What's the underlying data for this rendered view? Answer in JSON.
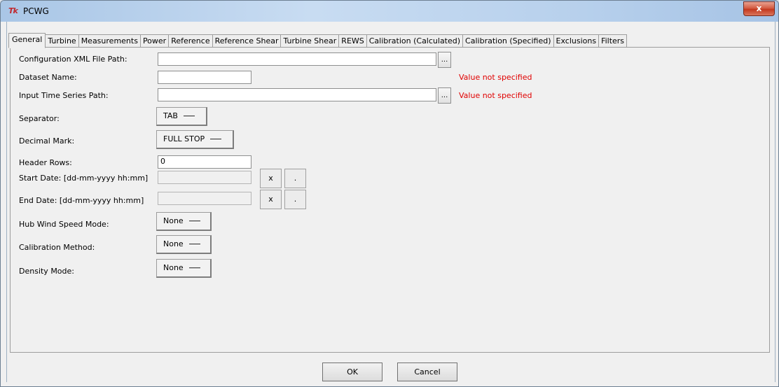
{
  "window": {
    "title": "PCWG",
    "logo": "Tk",
    "close_label": "x"
  },
  "tabs": [
    {
      "label": "General",
      "active": true
    },
    {
      "label": "Turbine"
    },
    {
      "label": "Measurements"
    },
    {
      "label": "Power"
    },
    {
      "label": "Reference"
    },
    {
      "label": "Reference Shear"
    },
    {
      "label": "Turbine Shear"
    },
    {
      "label": "REWS"
    },
    {
      "label": "Calibration (Calculated)"
    },
    {
      "label": "Calibration (Specified)"
    },
    {
      "label": "Exclusions"
    },
    {
      "label": "Filters"
    }
  ],
  "form": {
    "config_xml_label": "Configuration XML File Path:",
    "config_xml_value": "",
    "dataset_name_label": "Dataset Name:",
    "dataset_name_value": "",
    "dataset_name_error": "Value not specified",
    "input_ts_label": "Input Time Series Path:",
    "input_ts_value": "",
    "input_ts_error": "Value not specified",
    "browse_label": "...",
    "separator_label": "Separator:",
    "separator_value": "TAB",
    "decimal_label": "Decimal Mark:",
    "decimal_value": "FULL STOP",
    "header_rows_label": "Header Rows:",
    "header_rows_value": "0",
    "start_date_label": "Start Date: [dd-mm-yyyy hh:mm]",
    "end_date_label": "End Date: [dd-mm-yyyy hh:mm]",
    "clear_label": "x",
    "pick_label": ".",
    "hub_ws_label": "Hub Wind Speed Mode:",
    "hub_ws_value": "None",
    "calib_method_label": "Calibration Method:",
    "calib_method_value": "None",
    "density_label": "Density Mode:",
    "density_value": "None"
  },
  "buttons": {
    "ok": "OK",
    "cancel": "Cancel"
  }
}
